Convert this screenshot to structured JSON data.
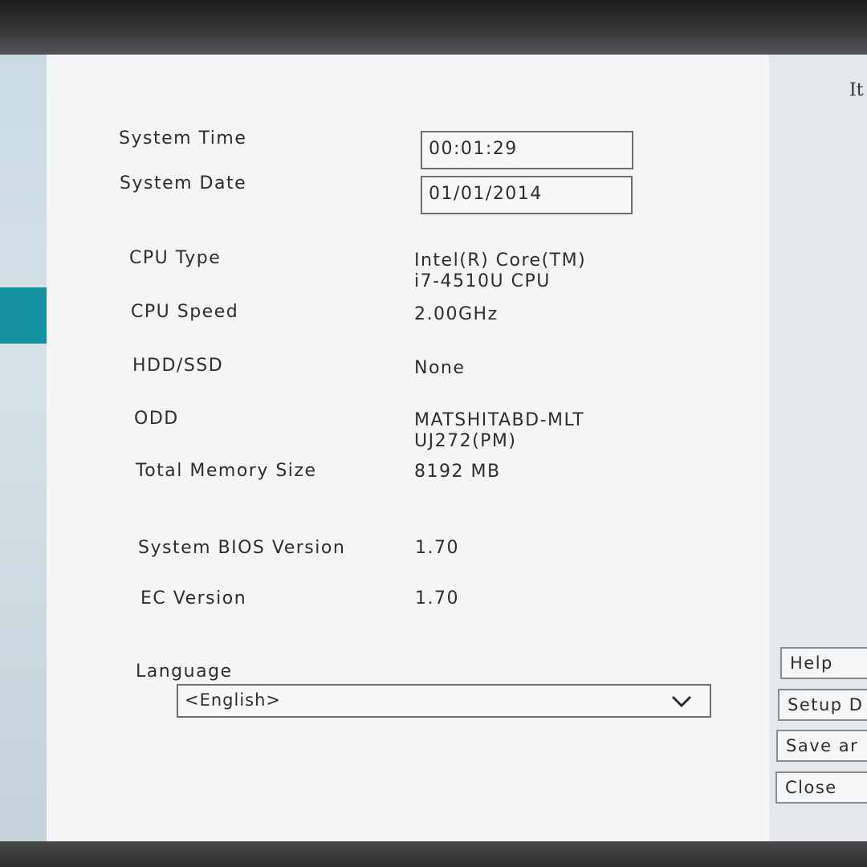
{
  "right_panel": {
    "title_fragment": "It"
  },
  "system": {
    "time_label": "System Time",
    "time_value": "00:01:29",
    "date_label": "System Date",
    "date_value": "01/01/2014"
  },
  "info": [
    {
      "label": "CPU Type",
      "value_line1": "Intel(R) Core(TM)",
      "value_line2": "i7-4510U CPU"
    },
    {
      "label": "CPU Speed",
      "value_line1": "2.00GHz",
      "value_line2": ""
    },
    {
      "label": "HDD/SSD",
      "value_line1": "None",
      "value_line2": ""
    },
    {
      "label": "ODD",
      "value_line1": "MATSHITABD-MLT",
      "value_line2": "UJ272(PM)"
    },
    {
      "label": "Total Memory Size",
      "value_line1": "8192 MB",
      "value_line2": ""
    },
    {
      "label": "System BIOS Version",
      "value_line1": "1.70",
      "value_line2": ""
    },
    {
      "label": "EC Version",
      "value_line1": "1.70",
      "value_line2": ""
    }
  ],
  "language": {
    "label": "Language",
    "selected": "<English>",
    "icon": "chevron-down-icon"
  },
  "buttons": {
    "help": "Help",
    "setup": "Setup D",
    "save": "Save ar",
    "close": "Close"
  },
  "colors": {
    "accent": "#1593a1"
  }
}
